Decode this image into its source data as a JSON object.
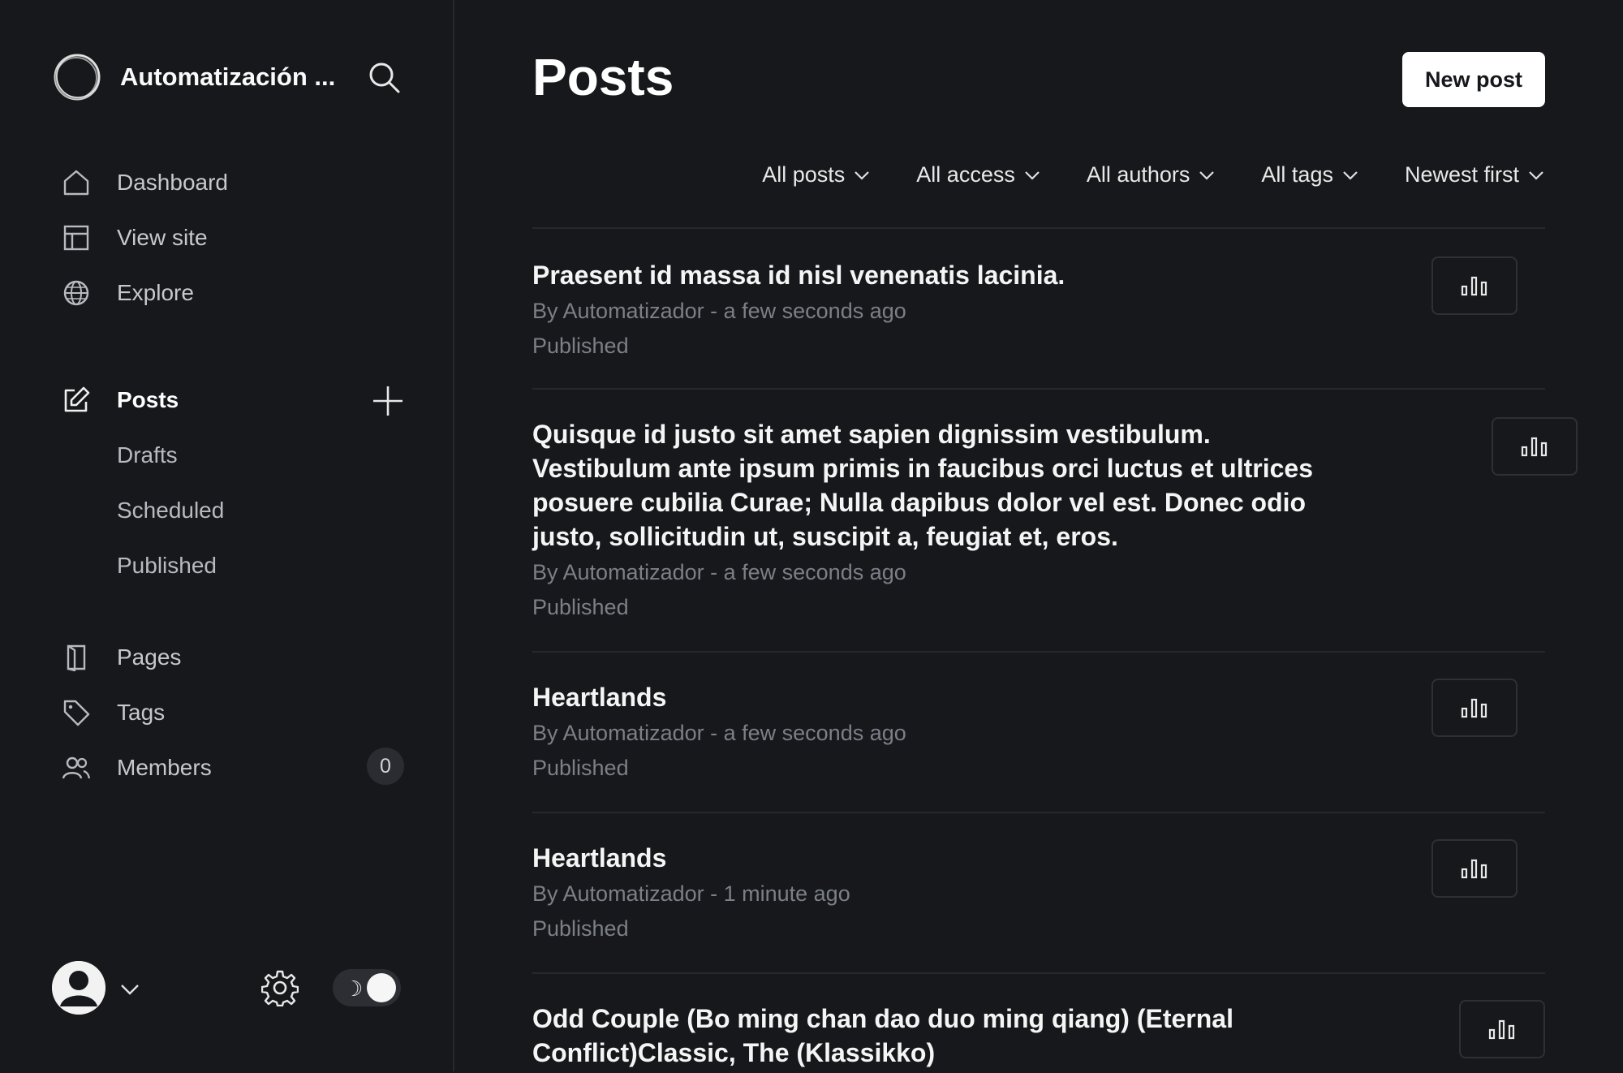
{
  "sidebar": {
    "site_title": "Automatización ...",
    "nav": [
      {
        "label": "Dashboard"
      },
      {
        "label": "View site"
      },
      {
        "label": "Explore"
      }
    ],
    "posts_label": "Posts",
    "post_subitems": [
      {
        "label": "Drafts"
      },
      {
        "label": "Scheduled"
      },
      {
        "label": "Published"
      }
    ],
    "nav2": [
      {
        "label": "Pages"
      },
      {
        "label": "Tags"
      },
      {
        "label": "Members",
        "badge": "0"
      }
    ]
  },
  "header": {
    "title": "Posts",
    "new_post_label": "New post"
  },
  "filters": [
    {
      "label": "All posts"
    },
    {
      "label": "All access"
    },
    {
      "label": "All authors"
    },
    {
      "label": "All tags"
    },
    {
      "label": "Newest first"
    }
  ],
  "posts": [
    {
      "title": "Praesent id massa id nisl venenatis lacinia.",
      "meta": "By Automatizador - a few seconds ago",
      "status": "Published"
    },
    {
      "title": "Quisque id justo sit amet sapien dignissim vestibulum. Vestibulum ante ipsum primis in faucibus orci luctus et ultrices posuere cubilia Curae; Nulla dapibus dolor vel est. Donec odio justo, sollicitudin ut, suscipit a, feugiat et, eros.",
      "meta": "By Automatizador - a few seconds ago",
      "status": "Published"
    },
    {
      "title": "Heartlands",
      "meta": "By Automatizador - a few seconds ago",
      "status": "Published"
    },
    {
      "title": "Heartlands",
      "meta": "By Automatizador - 1 minute ago",
      "status": "Published"
    },
    {
      "title": "Odd Couple (Bo ming chan dao duo ming qiang) (Eternal Conflict)Classic, The (Klassikko)",
      "meta": "",
      "status": ""
    }
  ],
  "colors": {
    "background": "#17181b",
    "accent_button": "#ffffff",
    "muted_text": "#7b7f87"
  }
}
